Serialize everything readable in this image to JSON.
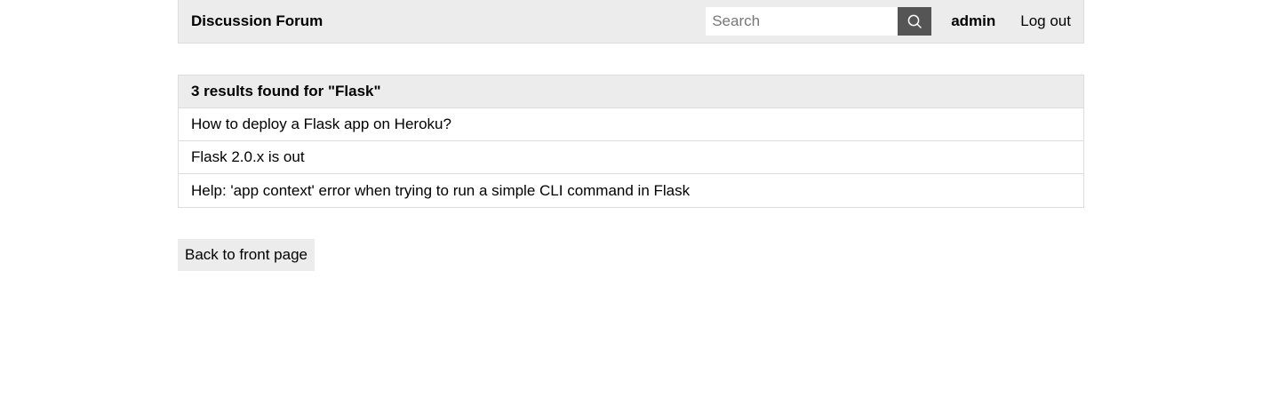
{
  "navbar": {
    "brand": "Discussion Forum",
    "search": {
      "placeholder": "Search",
      "value": "",
      "button_icon": "search-icon"
    },
    "username": "admin",
    "logout_label": "Log out"
  },
  "results": {
    "header": "3 results found for \"Flask\"",
    "items": [
      {
        "title": "How to deploy a Flask app on Heroku?"
      },
      {
        "title": "Flask 2.0.x is out"
      },
      {
        "title": "Help: 'app context' error when trying to run a simple CLI command in Flask"
      }
    ]
  },
  "back_label": "Back to front page",
  "colors": {
    "navbar_bg": "#ececec",
    "search_button_bg": "#555555",
    "border": "#dddddd"
  }
}
